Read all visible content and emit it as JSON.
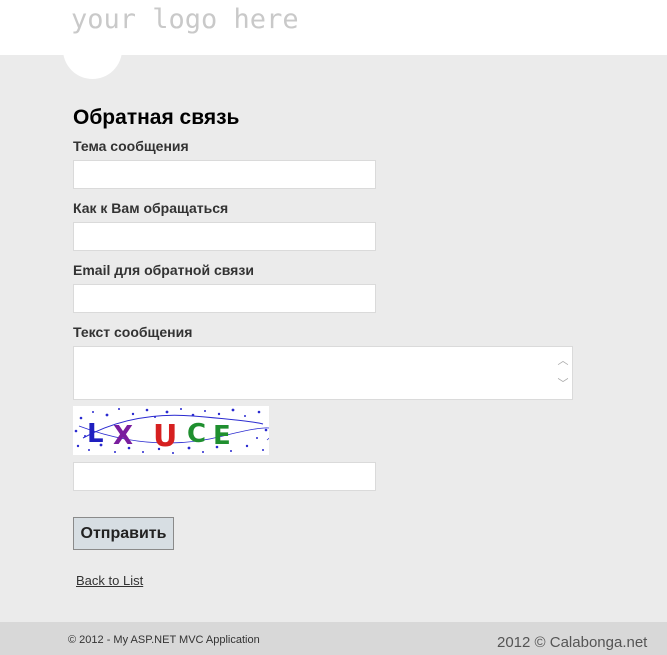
{
  "header": {
    "logo_text": "your logo here"
  },
  "form": {
    "title": "Обратная связь",
    "subject_label": "Тема сообщения",
    "subject_value": "",
    "name_label": "Как к Вам обращаться",
    "name_value": "",
    "email_label": "Email для обратной связи",
    "email_value": "",
    "message_label": "Текст сообщения",
    "message_value": "",
    "captcha_text": "LXUCE",
    "captcha_value": "",
    "submit_label": "Отправить"
  },
  "links": {
    "back": "Back to List"
  },
  "footer": {
    "copyright": "© 2012 - My ASP.NET MVC Application",
    "watermark": "2012 © Calabonga.net"
  },
  "colors": {
    "page_bg": "#ebebeb",
    "header_bg": "#ffffff",
    "logo": "#c9c9c9",
    "footer_bg": "#d8d8d8",
    "button_bg": "#d7dee3",
    "captcha_letters": [
      "#1f1fbf",
      "#7a1d9e",
      "#d62020",
      "#1f8f2f",
      "#1f1fbf"
    ]
  }
}
